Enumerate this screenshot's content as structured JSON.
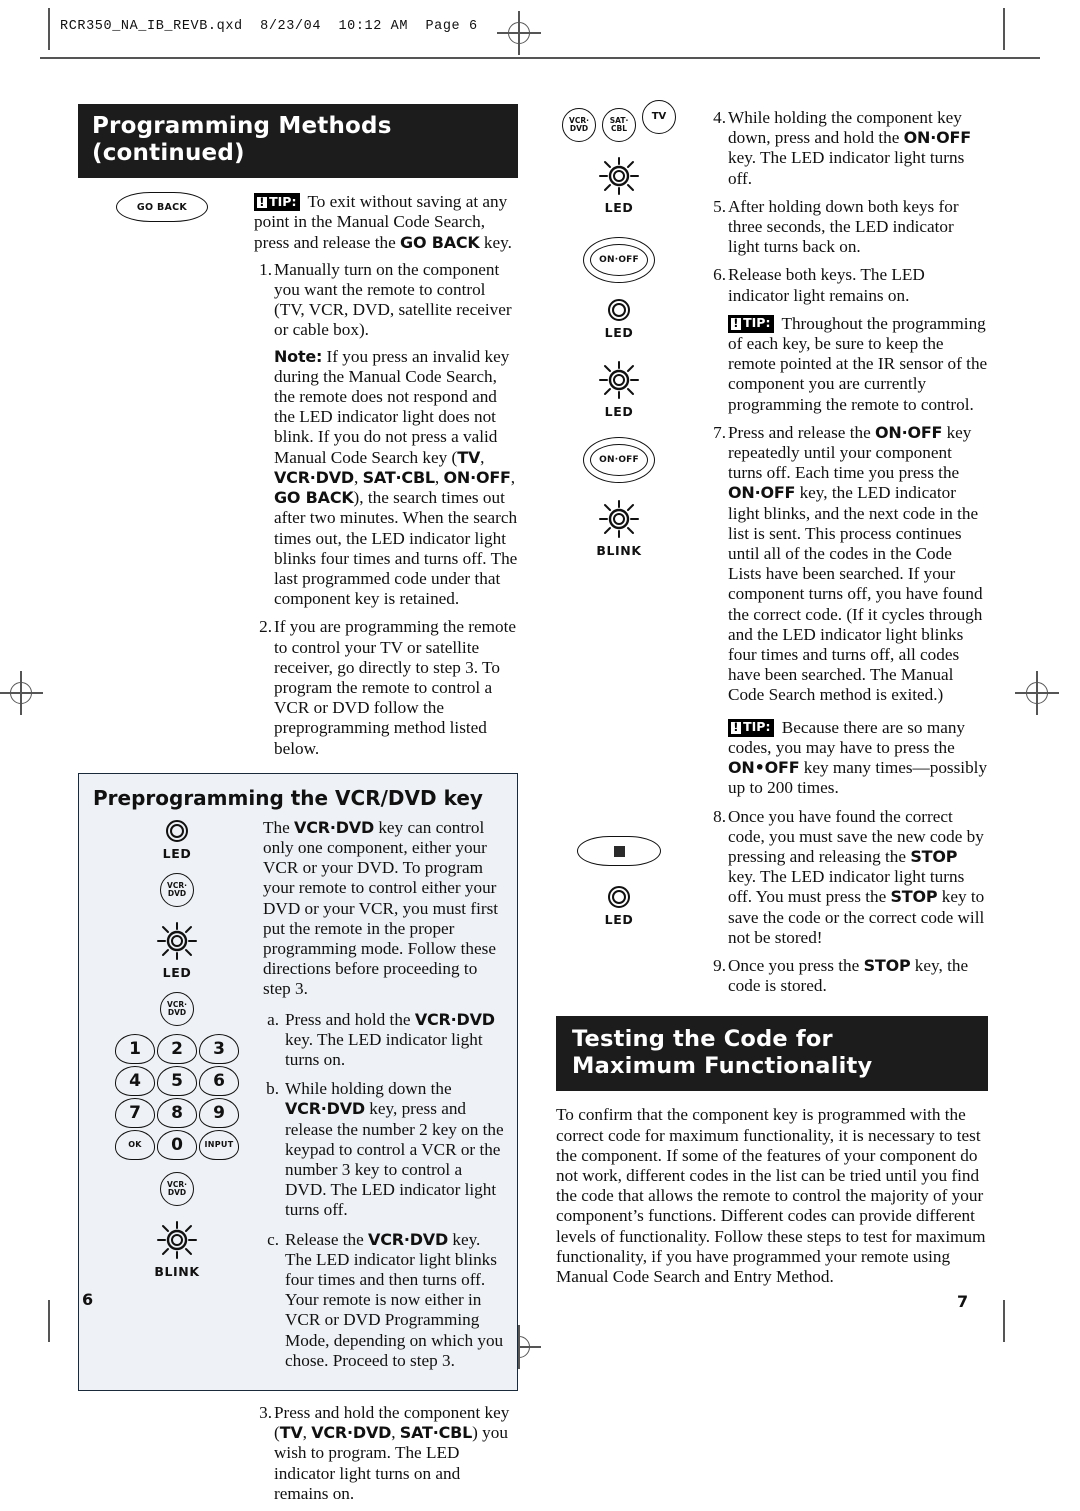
{
  "file_header": "RCR350_NA_IB_REVB.qxd  8/23/04  10:12 AM  Page 6",
  "page_numbers": {
    "left": "6",
    "right": "7"
  },
  "left_column": {
    "banner": "Programming Methods (continued)",
    "goback_key_label": "GO BACK",
    "tip_label": "TIP:",
    "tip_bang": "!",
    "tip_text_1": " To exit without saving at any point in the Manual Code Search, press and release the ",
    "tip_bold_1": "GO BACK",
    "tip_text_1b": " key.",
    "step1_num": "1.",
    "step1_text": "Manually turn on the component you want the remote to control (TV, VCR, DVD, satellite receiver or cable box).",
    "note_label": "Note:",
    "note_text_a": " If you press an invalid key during the Manual Code Search, the remote does not respond and the LED indicator light does not blink. If you do not press a valid Manual Code Search key (",
    "note_keys": [
      "TV",
      "VCR·DVD",
      "SAT·CBL",
      "ON·OFF",
      "GO BACK"
    ],
    "note_text_b": "), the search times out after two minutes. When the search times out, the LED indicator light blinks four times and turns off. The last programmed code under that component key is retained.",
    "step2_num": "2.",
    "step2_text": "If you are programming the remote to control your TV or satellite receiver, go directly to step 3. To program the remote to control a VCR or DVD follow the preprogramming method listed below.",
    "step3_num": "3.",
    "step3_text_a": "Press and hold the component key (",
    "step3_keys": [
      "TV",
      "VCR·DVD",
      "SAT·CBL"
    ],
    "step3_text_b": ") you wish to program. The LED indicator light turns on and remains on."
  },
  "panel": {
    "title": "Preprogramming the VCR/DVD key",
    "intro_a": "The ",
    "intro_key": "VCR·DVD",
    "intro_b": " key can control only one component, either your VCR or your DVD. To program your remote to control either your DVD or your VCR, you must first put the remote in the proper programming mode. Follow these directions before proceeding to step 3.",
    "item_a_num": "a.",
    "item_a_text_1": "Press and hold the ",
    "item_a_key": "VCR·DVD",
    "item_a_text_2": " key. The LED indicator light turns on.",
    "item_b_num": "b.",
    "item_b_text_1": "While holding down the ",
    "item_b_key": "VCR·DVD",
    "item_b_text_2": " key, press and release the number 2 key on the keypad to control a VCR or the number 3 key to control a DVD. The LED indicator light turns off.",
    "item_c_num": "c.",
    "item_c_text_1": "Release the ",
    "item_c_key": "VCR·DVD",
    "item_c_text_2": " key. The LED indicator light blinks four times and then turns off. Your remote is now either in VCR or DVD Programming Mode, depending on which you chose. Proceed to step 3.",
    "icons": {
      "led_label": "LED",
      "blink_label": "BLINK",
      "vcrdvd_key": "VCR·\nDVD",
      "numpad": [
        "1",
        "2",
        "3",
        "4",
        "5",
        "6",
        "7",
        "8",
        "9",
        "OK",
        "0",
        "INPUT"
      ]
    }
  },
  "right_column": {
    "icons": {
      "vcrdvd_key": "VCR·\nDVD",
      "satcbl_key": "SAT·\nCBL",
      "tv_key": "TV",
      "onoff_key": "ON·OFF",
      "led_label": "LED",
      "blink_label": "BLINK",
      "stop_key": "STOP"
    },
    "step4_num": "4.",
    "step4_text_a": "While holding the component key down, press and hold the ",
    "step4_key": "ON·OFF",
    "step4_text_b": " key. The LED indicator light turns off.",
    "step5_num": "5.",
    "step5_text": "After holding down both keys for three seconds, the LED indicator light turns back on.",
    "step6_num": "6.",
    "step6_text": "Release both keys. The LED indicator light remains on.",
    "tip1_label": "TIP:",
    "tip1_text": " Throughout the programming of each key, be sure to keep the remote pointed at the IR sensor of the component you are currently programming the remote to control.",
    "step7_num": "7.",
    "step7_text_a": "Press and release the ",
    "step7_key1": "ON·OFF",
    "step7_text_b": " key repeatedly until your component turns off. Each time you press the ",
    "step7_key2": "ON·OFF",
    "step7_text_c": " key, the LED indicator light blinks, and the next code in the list is sent. This process continues until all of the codes in the Code Lists have been searched. If your component turns off, you have found the correct code. (If it cycles through and the LED indicator light blinks four times and turns off, all codes have been searched. The Manual Code Search method is exited.)",
    "tip2_label": "TIP:",
    "tip2_text_a": " Because there are so many codes, you may have to press the ",
    "tip2_key": "ON•OFF",
    "tip2_text_b": " key many times—possibly up to 200 times.",
    "step8_num": "8.",
    "step8_text_a": "Once you have found the correct code, you must save the new code by pressing and releasing the ",
    "step8_key1": "STOP",
    "step8_text_b": " key. The LED indicator light turns off. You must press the ",
    "step8_key2": "STOP",
    "step8_text_c": " key to save the code or the correct code will not be stored!",
    "step9_num": "9.",
    "step9_text_a": "Once you press the ",
    "step9_key": "STOP",
    "step9_text_b": " key, the code is stored.",
    "banner_line1": "Testing the Code for",
    "banner_line2": "Maximum Functionality",
    "closing_text": "To confirm that the component key is programmed with the correct code for maximum functionality, it is necessary to test the component. If some of the features of your component do not work, different codes in the list can be tried until you find the code that allows the remote to control the majority of your component’s functions. Different codes can provide different levels of functionality. Follow these steps to test for maximum functionality, if you have programmed your remote using Manual Code Search and Entry Method."
  }
}
